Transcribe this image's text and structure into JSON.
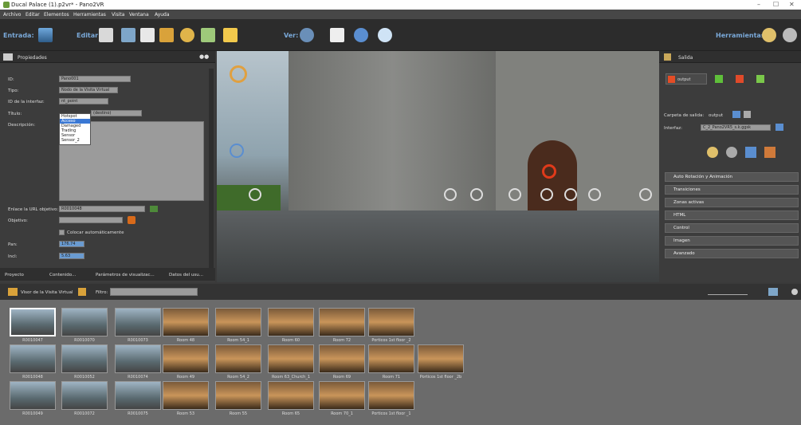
{
  "window": {
    "title": "Ducal Palace (1).p2vr* - Pano2VR",
    "min": "–",
    "max": "☐",
    "close": "✕"
  },
  "menu": [
    "Archivo",
    "Editar",
    "Elementos",
    "Herramientas",
    "Visita",
    "Ventana",
    "Ayuda"
  ],
  "toolbar": {
    "entrada": "Entrada:",
    "editar": "Editar:",
    "ver": "Ver:",
    "herramientas": "Herramientas:"
  },
  "left": {
    "title": "Propiedades",
    "id_label": "ID:",
    "id_value": "Pano001",
    "tipo_label": "Tipo:",
    "tipo_value": "Nodo de la Visita Virtual",
    "iface_label": "ID de la interfaz:",
    "iface_value": "nt_point",
    "titulo_label": "Título:",
    "titulo_value": "(destino)",
    "desc_label": "Descripción:",
    "dropdown": [
      "Hotspot",
      "Acceso",
      "Damaged",
      "Trading",
      "Sensor",
      "Sensor_2"
    ],
    "url_label": "Enlace la URL objetivo:",
    "url_value": "R0010048",
    "obj_label": "Objetivo:",
    "auto_label": "Colocar automáticamente",
    "pan_label": "Pan:",
    "pan_value": "176.74",
    "incl_label": "Incl:",
    "incl_value": "5.63",
    "tabs": [
      "Proyecto",
      "Contenido...",
      "Parámetros de visualizac...",
      "Datos del usu..."
    ]
  },
  "right": {
    "title": "Salida",
    "output_label": "output",
    "carpeta_label": "Carpeta de salida:",
    "carpeta_value": "output",
    "iface_label": "Interfaz:",
    "iface_value": "C_2_Pano2VR5_s.k.ggsk",
    "sections": [
      "Auto Rotación y Animación",
      "Transiciones",
      "Zonas activas",
      "HTML",
      "Control",
      "Imagen",
      "Avanzado"
    ]
  },
  "browser": {
    "title": "Visor de la Visita Virtual",
    "filter_label": "Filtro:",
    "rows": [
      [
        "R0010047",
        "R0010070",
        "R0010073",
        "Room 48",
        "Room 54_1",
        "Room 60",
        "Room 72",
        "Porticos 1st floor _2"
      ],
      [
        "R0010048",
        "R0010052",
        "R0010074",
        "Room 49",
        "Room 54_2",
        "Room 63_Church_1",
        "Room 69",
        "Room 71",
        "Porticos 1st floor _2b"
      ],
      [
        "R0010049",
        "R0010072",
        "R0010075",
        "Room 53",
        "Room 55",
        "Room 65",
        "Room 70_1",
        "Porticos 1st floor _1"
      ]
    ]
  },
  "colors": {
    "accent": "#3a78d4",
    "toolbar_label": "#7aa9d9"
  }
}
